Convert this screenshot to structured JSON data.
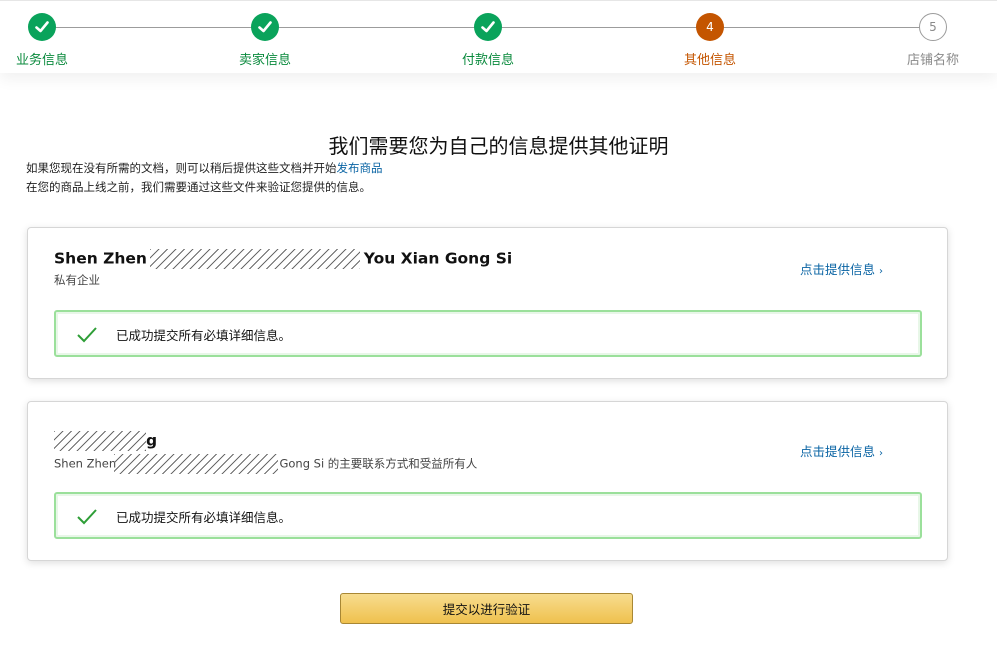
{
  "stepper": {
    "steps": [
      {
        "label": "业务信息",
        "state": "done",
        "number": ""
      },
      {
        "label": "卖家信息",
        "state": "done",
        "number": ""
      },
      {
        "label": "付款信息",
        "state": "done",
        "number": ""
      },
      {
        "label": "其他信息",
        "state": "current",
        "number": "4"
      },
      {
        "label": "店铺名称",
        "state": "todo",
        "number": "5"
      }
    ]
  },
  "page": {
    "title": "我们需要您为自己的信息提供其他证明",
    "intro_line1_text": "如果您现在没有所需的文档，则可以稍后提供这些文档并开始",
    "intro_line1_link": "发布商品",
    "intro_line2": "在您的商品上线之前，我们需要通过这些文件来验证您提供的信息。"
  },
  "cards": [
    {
      "name_start": "Shen Zhen",
      "name_end": "You Xian Gong Si",
      "subtitle": "私有企业",
      "link_label": "点击提供信息",
      "link_chevron": "›",
      "success_message": "已成功提交所有必填详细信息。"
    },
    {
      "name_end": "g",
      "subtitle_start": "Shen Zhen",
      "subtitle_end": "Gong Si 的主要联系方式和受益所有人",
      "link_label": "点击提供信息",
      "link_chevron": "›",
      "success_message": "已成功提交所有必填详细信息。"
    }
  ],
  "submit_label": "提交以进行验证",
  "colors": {
    "done": "#0aa35b",
    "current": "#c45500",
    "link": "#0a64a4",
    "success_border": "#9be09b",
    "button": "#efc14e"
  }
}
